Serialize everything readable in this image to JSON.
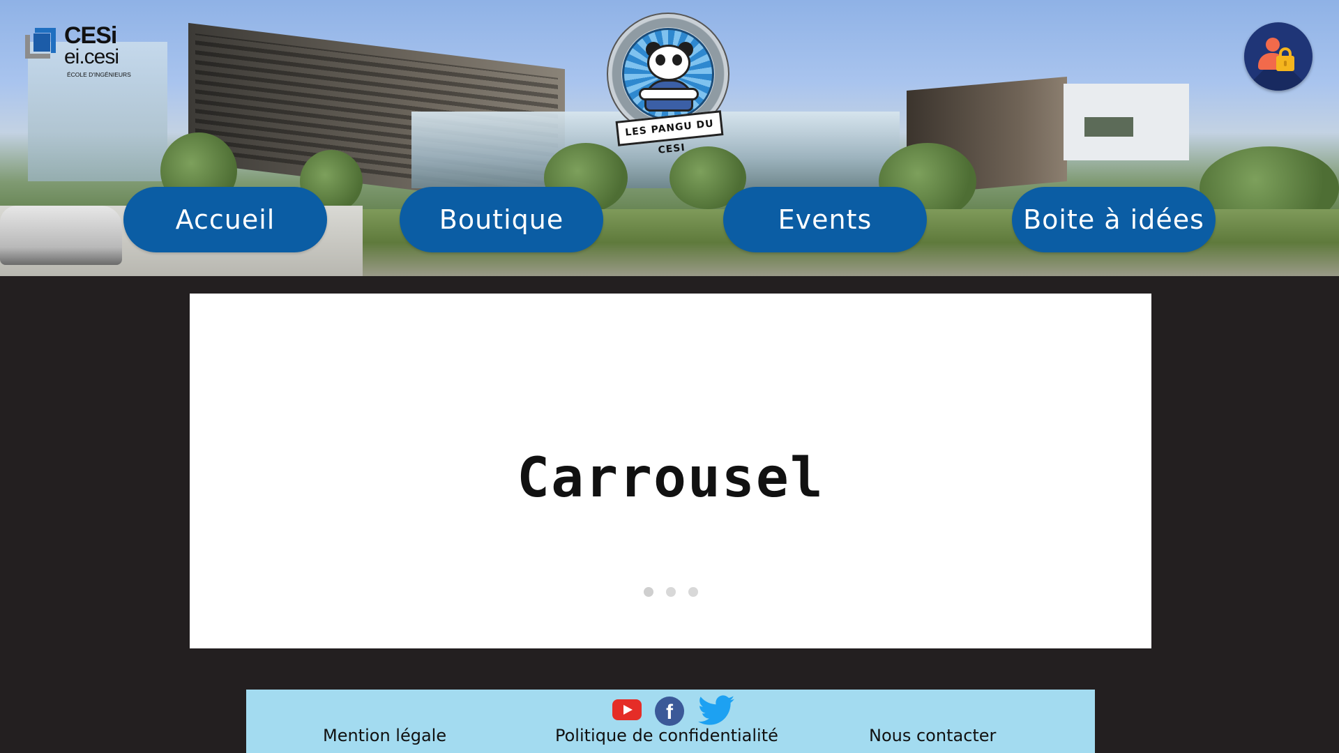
{
  "brand": {
    "cesi_line1": "CESi",
    "cesi_line2": "ei.cesi",
    "cesi_line3": "ÉCOLE D'INGÉNIEURS",
    "mascot_banner": "LES PANGU DU CESI"
  },
  "nav": {
    "items": [
      {
        "label": "Accueil"
      },
      {
        "label": "Boutique"
      },
      {
        "label": "Events"
      },
      {
        "label": "Boite à idées"
      }
    ]
  },
  "carousel": {
    "title": "Carrousel",
    "slides_count": 3,
    "active_slide": 1
  },
  "footer": {
    "social": [
      "youtube-icon",
      "facebook-icon",
      "twitter-icon"
    ],
    "facebook_glyph": "f",
    "links": [
      {
        "label": "Mention légale"
      },
      {
        "label": "Politique de confidentialité"
      },
      {
        "label": "Nous contacter"
      }
    ]
  },
  "colors": {
    "page_bg": "#231f20",
    "nav_button": "#0b5da4",
    "footer_bg": "#a3dbf0",
    "carousel_bg": "#ffffff"
  }
}
